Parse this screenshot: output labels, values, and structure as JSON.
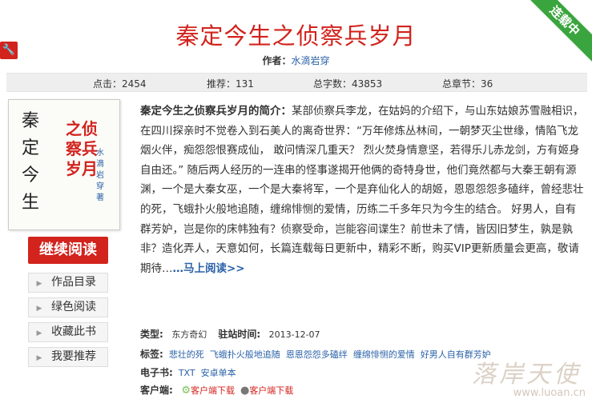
{
  "ribbon": "连载中",
  "title": "秦定今生之侦察兵岁月",
  "author_label": "作者：",
  "author_name": "水滴岩穿",
  "stats": {
    "clicks": "点击：2454",
    "recommends": "推荐：131",
    "words": "总字数：43853",
    "chapters": "总章节：36"
  },
  "cover": {
    "col1": [
      "秦",
      "定",
      "今",
      "生"
    ],
    "subtitle": [
      "之侦",
      "察兵",
      "岁月"
    ],
    "pen": "水滴岩穿著"
  },
  "buttons": {
    "continue": "继续阅读",
    "catalog": "作品目录",
    "green": "绿色阅读",
    "bookmark": "收藏此书",
    "recommend": "我要推荐"
  },
  "intro": {
    "heading": "秦定今生之侦察兵岁月的简介：",
    "body": "某部侦察兵李龙，在姑妈的介绍下，与山东姑娘苏雪融相识，在四川探亲时不觉卷入到石美人的离奇世界：“万年修炼丛林间，一朝梦灭尘世缘，情陷飞龙烟火伴，痴怨怨恨赛成仙， 敢问情深几重天？ 烈火焚身情意坚，若得乐儿赤龙剑，方有姬身自由还。” 随后两人经历的一连串的怪事遂揭开他俩的奇特身世，他们竟然都与大秦王朝有源渊，一个是大秦女巫，一个是大秦将军，一个是弃仙化人的胡姬，恩恩怨怨多磕绊，曾经悲壮的死，飞蛾扑火般地追随，缠绵悱恻的爱情，历练二千多年只为今生的结合。 好男人，自有群芳妒，岂是你的床帏独有？侦察受命，岂能容间谍生？前世未了情，皆因旧梦生，孰是孰非？造化弄人，天意如何，长篇连载每日更新中，精彩不断，购买VIP更新质量会更高，敬请期待…",
    "more": "…马上阅读>>"
  },
  "meta": {
    "type_label": "类型:",
    "type_value": "东方奇幻",
    "date_label": "驻站时间:",
    "date_value": "2013-12-07",
    "tags_label": "标签:",
    "tags": [
      "悲壮的死",
      "飞蛾扑火般地追随",
      "恩恩怨怨多磕绊",
      "缠绵悱恻的爱情",
      "好男人自有群芳妒"
    ],
    "ebook_label": "电子书:",
    "ebook_txt": "TXT",
    "ebook_android": "安卓单本",
    "client_label": "客户端:",
    "client_android": "客户端下载",
    "client_ios": "客户端下载"
  },
  "watermark": {
    "cn": "落岸天使",
    "url": "www.luoan.cn"
  },
  "colors": {
    "accent": "#d2231d",
    "link": "#2b62a8",
    "ribbon": "#3aa53e"
  }
}
